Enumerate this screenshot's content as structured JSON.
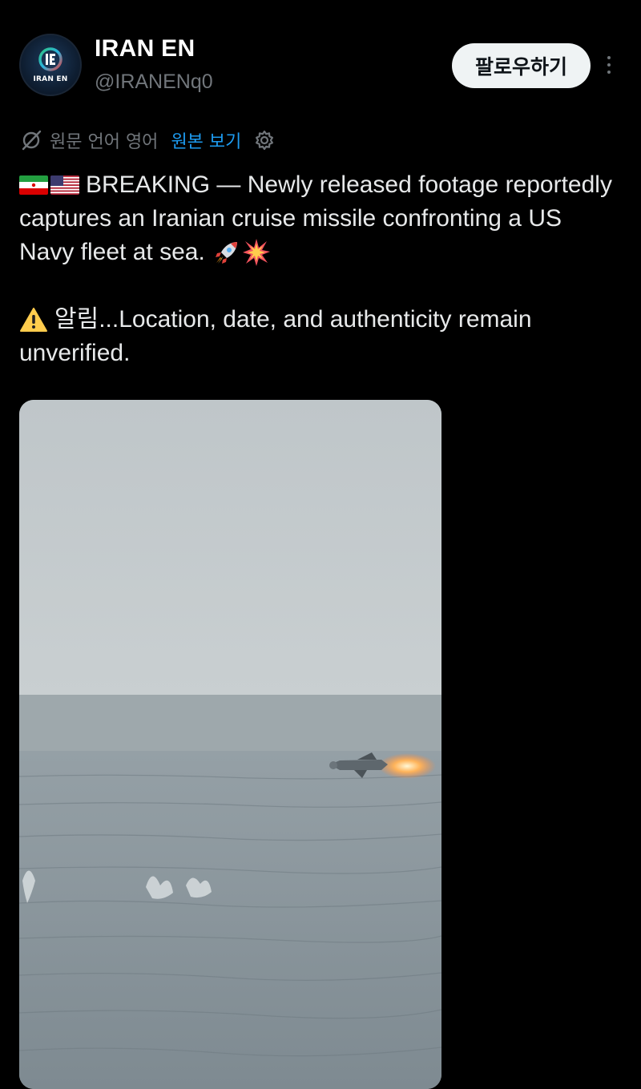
{
  "user": {
    "avatar_label": "IRAN EN",
    "display_name": "IRAN EN",
    "handle": "@IRANENq0"
  },
  "actions": {
    "follow_label": "팔로우하기"
  },
  "translation": {
    "original_language": "원문 언어 영어",
    "view_original_label": "원본 보기"
  },
  "tweet": {
    "line1": "BREAKING — Newly released footage reportedly",
    "line2": "captures an Iranian cruise missile confronting a US",
    "line3": "Navy fleet at sea.",
    "line4": "알림...Location, date, and authenticity remain",
    "line5": "unverified."
  },
  "icons": {
    "flags": [
      "iran-flag-icon",
      "us-flag-icon"
    ],
    "emoji": [
      "rocket-icon",
      "collision-icon",
      "warning-icon"
    ]
  },
  "colors": {
    "background": "#000000",
    "link": "#1d9bf0",
    "secondary_text": "#71767b",
    "primary_text": "#e7e9ea",
    "follow_button_bg": "#eff3f4"
  }
}
